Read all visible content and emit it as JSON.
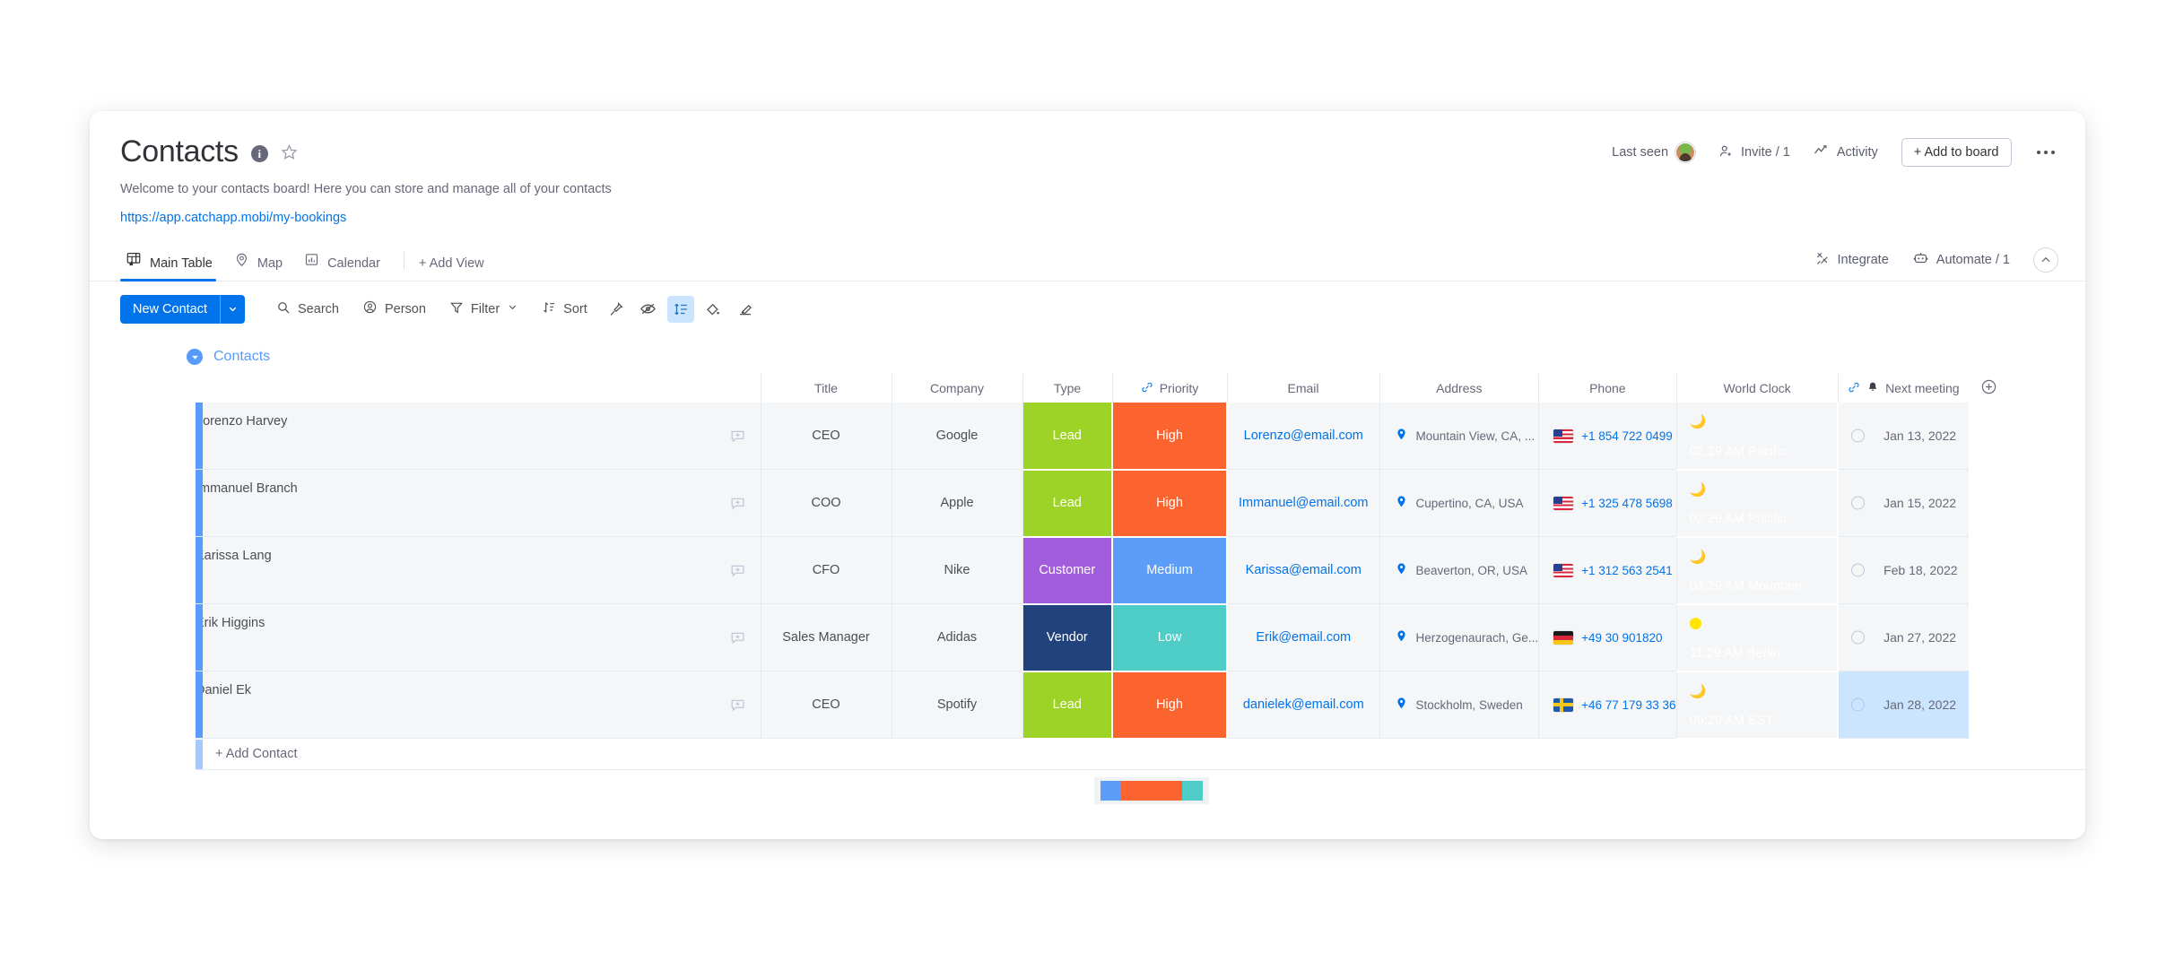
{
  "header": {
    "title": "Contacts",
    "description": "Welcome to your contacts board! Here you can store and manage all of your contacts",
    "link": "https://app.catchapp.mobi/my-bookings",
    "info_icon": "info-icon",
    "star_icon": "star-outline-icon",
    "last_seen_label": "Last seen",
    "invite_label": "Invite / 1",
    "activity_label": "Activity",
    "add_to_board_label": "+ Add to board",
    "more_label": "more-options"
  },
  "tabs": [
    {
      "label": "Main Table",
      "icon": "table-home-icon",
      "active": true
    },
    {
      "label": "Map",
      "icon": "map-pin-icon",
      "active": false
    },
    {
      "label": "Calendar",
      "icon": "chart-bars-icon",
      "active": false
    }
  ],
  "add_view_label": "+ Add View",
  "tabs_right": {
    "integrate_label": "Integrate",
    "automate_label": "Automate / 1",
    "collapse_icon": "chevron-up-icon"
  },
  "toolbar": {
    "new_item_label": "New Contact",
    "new_item_caret": "chevron-down-icon",
    "search_label": "Search",
    "person_label": "Person",
    "filter_label": "Filter",
    "sort_label": "Sort",
    "icons": [
      {
        "name": "pin-icon",
        "active": false
      },
      {
        "name": "eye-off-icon",
        "active": false
      },
      {
        "name": "row-height-icon",
        "active": true
      },
      {
        "name": "color-bucket-icon",
        "active": false
      },
      {
        "name": "brush-icon",
        "active": false
      }
    ]
  },
  "group": {
    "name": "Contacts",
    "color": "#579bfc",
    "collapse_icon": "caret-down-icon"
  },
  "columns": [
    {
      "key": "name",
      "label": ""
    },
    {
      "key": "title",
      "label": "Title"
    },
    {
      "key": "company",
      "label": "Company"
    },
    {
      "key": "type",
      "label": "Type"
    },
    {
      "key": "priority",
      "label": "Priority",
      "icon": "link-icon",
      "highlight": true
    },
    {
      "key": "email",
      "label": "Email"
    },
    {
      "key": "address",
      "label": "Address"
    },
    {
      "key": "phone",
      "label": "Phone"
    },
    {
      "key": "world_clock",
      "label": "World Clock"
    },
    {
      "key": "next_meeting",
      "label": "Next meeting",
      "icon": "link-icon",
      "icon2": "bell-icon",
      "highlight": true
    }
  ],
  "add_column_icon": "plus-circle-icon",
  "rows": [
    {
      "name": "Lorenzo Harvey",
      "title": "CEO",
      "company": "Google",
      "type": "Lead",
      "type_color": "#9CD326",
      "priority": "High",
      "priority_color": "#FB642E",
      "email": "Lorenzo@email.com",
      "address": "Mountain View, CA, ...",
      "flag": "us",
      "phone": "+1 854 722 0499",
      "clock_time": "02:29 AM Pacific",
      "clock_mode": "night",
      "next_meeting": "Jan 13, 2022",
      "meeting_selected": false
    },
    {
      "name": "Immanuel Branch",
      "title": "COO",
      "company": "Apple",
      "type": "Lead",
      "type_color": "#9CD326",
      "priority": "High",
      "priority_color": "#FB642E",
      "email": "Immanuel@email.com",
      "address": "Cupertino, CA, USA",
      "flag": "us",
      "phone": "+1 325 478 5698",
      "clock_time": "02:29 AM Pacific",
      "clock_mode": "night",
      "next_meeting": "Jan 15, 2022",
      "meeting_selected": false
    },
    {
      "name": "Karissa Lang",
      "title": "CFO",
      "company": "Nike",
      "type": "Customer",
      "type_color": "#A25DDC",
      "priority": "Medium",
      "priority_color": "#5B9DF9",
      "email": "Karissa@email.com",
      "address": "Beaverton, OR, USA",
      "flag": "us",
      "phone": "+1 312 563 2541",
      "clock_time": "03:29 AM Mountain",
      "clock_mode": "night",
      "next_meeting": "Feb 18, 2022",
      "meeting_selected": false
    },
    {
      "name": "Erik Higgins",
      "title": "Sales Manager",
      "company": "Adidas",
      "type": "Vendor",
      "type_color": "#22427C",
      "priority": "Low",
      "priority_color": "#4ECCC6",
      "email": "Erik@email.com",
      "address": "Herzogenaurach, Ge...",
      "flag": "de",
      "phone": "+49 30 901820",
      "clock_time": "11:29 AM Berlin",
      "clock_mode": "day",
      "next_meeting": "Jan 27, 2022",
      "meeting_selected": false
    },
    {
      "name": "Daniel Ek",
      "title": "CEO",
      "company": "Spotify",
      "type": "Lead",
      "type_color": "#9CD326",
      "priority": "High",
      "priority_color": "#FB642E",
      "email": "danielek@email.com",
      "address": "Stockholm, Sweden",
      "flag": "se",
      "phone": "+46 77 179 33 36",
      "clock_time": "05:29 AM EST",
      "clock_mode": "night",
      "next_meeting": "Jan 28, 2022",
      "meeting_selected": true
    }
  ],
  "add_row_label": "+ Add Contact",
  "summary": {
    "column": "priority",
    "segments": [
      {
        "label": "Medium",
        "color": "#5B9DF9",
        "count": 1
      },
      {
        "label": "High",
        "color": "#FB642E",
        "count": 3
      },
      {
        "label": "Low",
        "color": "#4ECCC6",
        "count": 1
      }
    ]
  }
}
